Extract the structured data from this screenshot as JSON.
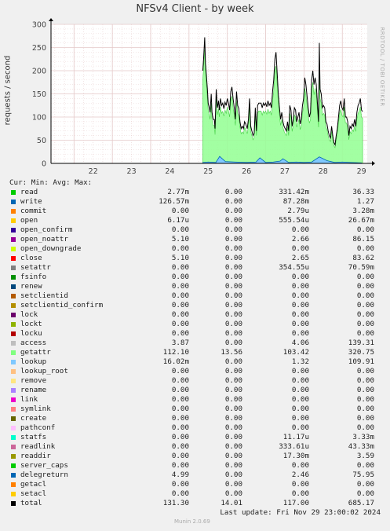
{
  "title": "NFSv4 Client - by week",
  "watermark": "RRDTOOL / TOBI OETIKER",
  "footer": "Last update: Fri Nov 29 23:00:02 2024",
  "version": "Munin 2.0.69",
  "colors": {
    "background": "#f0f0f0",
    "plot_background": "#ffffff",
    "grid": "#e4c8c8",
    "total_line": "#000000",
    "getattr_fill": "#99ff99"
  },
  "chart_data": {
    "type": "line",
    "title": "NFSv4 Client - by week",
    "xlabel": "",
    "ylabel": "requests / second",
    "x_range": [
      21.4,
      29.65
    ],
    "ylim": [
      0,
      300
    ],
    "yticks": [
      0,
      50,
      100,
      150,
      200,
      250,
      300
    ],
    "xticks": [
      22,
      23,
      24,
      25,
      26,
      27,
      28,
      29
    ],
    "xtick_labels": [
      "22",
      "23",
      "24",
      "25",
      "26",
      "27",
      "28",
      "29"
    ],
    "grid": true,
    "series": [
      {
        "name": "total",
        "color": "#000000",
        "x": [
          25.36,
          25.38,
          25.41,
          25.43,
          25.45,
          25.48,
          25.5,
          25.53,
          25.55,
          25.58,
          25.6,
          25.63,
          25.66,
          25.68,
          25.71,
          25.74,
          25.77,
          25.79,
          25.82,
          25.85,
          25.88,
          25.91,
          25.94,
          25.97,
          26.0,
          26.03,
          26.06,
          26.09,
          26.12,
          26.15,
          26.18,
          26.21,
          26.24,
          26.27,
          26.3,
          26.33,
          26.36,
          26.39,
          26.42,
          26.45,
          26.48,
          26.52,
          26.55,
          26.58,
          26.61,
          26.64,
          26.67,
          26.7,
          26.73,
          26.76,
          26.79,
          26.82,
          26.85,
          26.88,
          26.91,
          26.94,
          26.97,
          27.0,
          27.03,
          27.06,
          27.09,
          27.12,
          27.15,
          27.18,
          27.21,
          27.24,
          27.27,
          27.3,
          27.33,
          27.36,
          27.39,
          27.42,
          27.45,
          27.48,
          27.51,
          27.54,
          27.57,
          27.6,
          27.63,
          27.66,
          27.69,
          27.72,
          27.75,
          27.78,
          27.81,
          27.84,
          27.87,
          27.9,
          27.93,
          27.96,
          27.99,
          28.02,
          28.05,
          28.08,
          28.11,
          28.14,
          28.17,
          28.2,
          28.23,
          28.26,
          28.29,
          28.32,
          28.35,
          28.38,
          28.4,
          28.42,
          28.45,
          28.48,
          28.51,
          28.54,
          28.57,
          28.6,
          28.63,
          28.66,
          28.69,
          28.72,
          28.75,
          28.78,
          28.81,
          28.84,
          28.87,
          28.9,
          28.93,
          28.96,
          28.99,
          29.02,
          29.05,
          29.08,
          29.11,
          29.14,
          29.17,
          29.2,
          29.23,
          29.26,
          29.29,
          29.32,
          29.35,
          29.38,
          29.41,
          29.44,
          29.47,
          29.5,
          29.53
        ],
        "values": [
          200,
          225,
          272,
          215,
          195,
          160,
          130,
          120,
          110,
          150,
          110,
          95,
          95,
          75,
          160,
          120,
          135,
          115,
          140,
          125,
          130,
          118,
          132,
          125,
          140,
          130,
          115,
          155,
          165,
          140,
          120,
          95,
          155,
          125,
          118,
          90,
          75,
          80,
          75,
          90,
          85,
          75,
          95,
          140,
          80,
          70,
          60,
          65,
          120,
          70,
          125,
          130,
          130,
          130,
          120,
          130,
          125,
          130,
          122,
          135,
          125,
          130,
          120,
          155,
          180,
          225,
          240,
          195,
          150,
          120,
          95,
          110,
          90,
          80,
          75,
          70,
          90,
          70,
          125,
          115,
          80,
          95,
          120,
          115,
          90,
          100,
          110,
          85,
          95,
          125,
          140,
          185,
          170,
          145,
          120,
          100,
          110,
          180,
          200,
          170,
          185,
          170,
          130,
          90,
          260,
          160,
          150,
          120,
          125,
          120,
          90,
          85,
          70,
          60,
          55,
          80,
          60,
          45,
          40,
          60,
          75,
          100,
          125,
          135,
          120,
          115,
          140,
          100,
          100,
          90,
          60,
          80,
          75,
          85,
          80,
          95,
          80,
          110,
          125,
          130,
          140,
          115,
          112
        ]
      },
      {
        "name": "getattr",
        "color": "#99ff99",
        "x": [
          25.36,
          25.38,
          25.41,
          25.43,
          25.45,
          25.48,
          25.5,
          25.53,
          25.55,
          25.58,
          25.6,
          25.63,
          25.66,
          25.68,
          25.71,
          25.74,
          25.77,
          25.79,
          25.82,
          25.85,
          25.88,
          25.91,
          25.94,
          25.97,
          26.0,
          26.03,
          26.06,
          26.09,
          26.12,
          26.15,
          26.18,
          26.21,
          26.24,
          26.27,
          26.3,
          26.33,
          26.36,
          26.39,
          26.42,
          26.45,
          26.48,
          26.52,
          26.55,
          26.58,
          26.61,
          26.64,
          26.67,
          26.7,
          26.73,
          26.76,
          26.79,
          26.82,
          26.85,
          26.88,
          26.91,
          26.94,
          26.97,
          27.0,
          27.03,
          27.06,
          27.09,
          27.12,
          27.15,
          27.18,
          27.21,
          27.24,
          27.27,
          27.3,
          27.33,
          27.36,
          27.39,
          27.42,
          27.45,
          27.48,
          27.51,
          27.54,
          27.57,
          27.6,
          27.63,
          27.66,
          27.69,
          27.72,
          27.75,
          27.78,
          27.81,
          27.84,
          27.87,
          27.9,
          27.93,
          27.96,
          27.99,
          28.02,
          28.05,
          28.08,
          28.11,
          28.14,
          28.17,
          28.2,
          28.23,
          28.26,
          28.29,
          28.32,
          28.35,
          28.38,
          28.4,
          28.42,
          28.45,
          28.48,
          28.51,
          28.54,
          28.57,
          28.6,
          28.63,
          28.66,
          28.69,
          28.72,
          28.75,
          28.78,
          28.81,
          28.84,
          28.87,
          28.9,
          28.93,
          28.96,
          28.99,
          29.02,
          29.05,
          29.08,
          29.11,
          29.14,
          29.17,
          29.2,
          29.23,
          29.26,
          29.29,
          29.32,
          29.35,
          29.38,
          29.41,
          29.44,
          29.47,
          29.5,
          29.53
        ],
        "values": [
          180,
          205,
          245,
          195,
          175,
          140,
          115,
          105,
          95,
          130,
          95,
          82,
          82,
          62,
          140,
          105,
          118,
          100,
          122,
          108,
          112,
          102,
          115,
          108,
          122,
          113,
          100,
          135,
          145,
          122,
          104,
          82,
          135,
          108,
          102,
          78,
          64,
          68,
          64,
          78,
          73,
          64,
          82,
          122,
          69,
          60,
          51,
          56,
          104,
          60,
          108,
          113,
          113,
          113,
          104,
          113,
          108,
          113,
          106,
          117,
          108,
          113,
          104,
          135,
          157,
          197,
          210,
          170,
          130,
          104,
          82,
          95,
          78,
          69,
          64,
          60,
          78,
          60,
          108,
          100,
          69,
          82,
          104,
          100,
          78,
          87,
          95,
          73,
          82,
          108,
          122,
          162,
          148,
          126,
          104,
          87,
          95,
          157,
          175,
          148,
          162,
          148,
          113,
          78,
          200,
          140,
          130,
          104,
          108,
          104,
          78,
          73,
          60,
          51,
          47,
          69,
          51,
          38,
          34,
          51,
          64,
          87,
          108,
          117,
          104,
          100,
          122,
          87,
          87,
          78,
          51,
          69,
          64,
          73,
          69,
          82,
          69,
          95,
          108,
          113,
          122,
          100,
          97
        ]
      },
      {
        "name": "write",
        "color": "#0066b3",
        "x": [
          25.36,
          25.5,
          25.7,
          25.8,
          25.95,
          26.2,
          26.5,
          26.75,
          26.85,
          27.0,
          27.2,
          27.38,
          27.45,
          27.6,
          27.8,
          28.0,
          28.2,
          28.4,
          28.6,
          28.8,
          29.0,
          29.2,
          29.5
        ],
        "values": [
          2,
          3,
          2,
          15,
          4,
          3,
          2,
          3,
          12,
          2,
          3,
          5,
          10,
          2,
          3,
          2,
          3,
          14,
          6,
          2,
          3,
          2,
          1
        ]
      }
    ],
    "legend": {
      "headers": [
        "Cur:",
        "Min:",
        "Avg:",
        "Max:"
      ],
      "rows": [
        {
          "name": "read",
          "color": "#00cc00",
          "cur": "2.77m",
          "min": "0.00",
          "avg": "331.42m",
          "max": "36.33"
        },
        {
          "name": "write",
          "color": "#0066b3",
          "cur": "126.57m",
          "min": "0.00",
          "avg": "87.28m",
          "max": "1.27"
        },
        {
          "name": "commit",
          "color": "#ff8000",
          "cur": "0.00",
          "min": "0.00",
          "avg": "2.79u",
          "max": "3.28m"
        },
        {
          "name": "open",
          "color": "#ffcc00",
          "cur": "6.17u",
          "min": "0.00",
          "avg": "555.54u",
          "max": "26.67m"
        },
        {
          "name": "open_confirm",
          "color": "#330099",
          "cur": "0.00",
          "min": "0.00",
          "avg": "0.00",
          "max": "0.00"
        },
        {
          "name": "open_noattr",
          "color": "#990099",
          "cur": "5.10",
          "min": "0.00",
          "avg": "2.66",
          "max": "86.15"
        },
        {
          "name": "open_downgrade",
          "color": "#ccff00",
          "cur": "0.00",
          "min": "0.00",
          "avg": "0.00",
          "max": "0.00"
        },
        {
          "name": "close",
          "color": "#ff0000",
          "cur": "5.10",
          "min": "0.00",
          "avg": "2.65",
          "max": "83.62"
        },
        {
          "name": "setattr",
          "color": "#808080",
          "cur": "0.00",
          "min": "0.00",
          "avg": "354.55u",
          "max": "70.59m"
        },
        {
          "name": "fsinfo",
          "color": "#008f00",
          "cur": "0.00",
          "min": "0.00",
          "avg": "0.00",
          "max": "0.00"
        },
        {
          "name": "renew",
          "color": "#00487d",
          "cur": "0.00",
          "min": "0.00",
          "avg": "0.00",
          "max": "0.00"
        },
        {
          "name": "setclientid",
          "color": "#b35a00",
          "cur": "0.00",
          "min": "0.00",
          "avg": "0.00",
          "max": "0.00"
        },
        {
          "name": "setclientid_confirm",
          "color": "#b38f00",
          "cur": "0.00",
          "min": "0.00",
          "avg": "0.00",
          "max": "0.00"
        },
        {
          "name": "lock",
          "color": "#6b006b",
          "cur": "0.00",
          "min": "0.00",
          "avg": "0.00",
          "max": "0.00"
        },
        {
          "name": "lockt",
          "color": "#8fb300",
          "cur": "0.00",
          "min": "0.00",
          "avg": "0.00",
          "max": "0.00"
        },
        {
          "name": "locku",
          "color": "#b30000",
          "cur": "0.00",
          "min": "0.00",
          "avg": "0.00",
          "max": "0.00"
        },
        {
          "name": "access",
          "color": "#bebebe",
          "cur": "3.87",
          "min": "0.00",
          "avg": "4.06",
          "max": "139.31"
        },
        {
          "name": "getattr",
          "color": "#80ff80",
          "cur": "112.10",
          "min": "13.56",
          "avg": "103.42",
          "max": "320.75"
        },
        {
          "name": "lookup",
          "color": "#80c9ff",
          "cur": "16.02m",
          "min": "0.00",
          "avg": "1.32",
          "max": "109.91"
        },
        {
          "name": "lookup_root",
          "color": "#ffc080",
          "cur": "0.00",
          "min": "0.00",
          "avg": "0.00",
          "max": "0.00"
        },
        {
          "name": "remove",
          "color": "#ffe680",
          "cur": "0.00",
          "min": "0.00",
          "avg": "0.00",
          "max": "0.00"
        },
        {
          "name": "rename",
          "color": "#aa80ff",
          "cur": "0.00",
          "min": "0.00",
          "avg": "0.00",
          "max": "0.00"
        },
        {
          "name": "link",
          "color": "#ee00cc",
          "cur": "0.00",
          "min": "0.00",
          "avg": "0.00",
          "max": "0.00"
        },
        {
          "name": "symlink",
          "color": "#ff8080",
          "cur": "0.00",
          "min": "0.00",
          "avg": "0.00",
          "max": "0.00"
        },
        {
          "name": "create",
          "color": "#666600",
          "cur": "0.00",
          "min": "0.00",
          "avg": "0.00",
          "max": "0.00"
        },
        {
          "name": "pathconf",
          "color": "#ffbfff",
          "cur": "0.00",
          "min": "0.00",
          "avg": "0.00",
          "max": "0.00"
        },
        {
          "name": "statfs",
          "color": "#00ffcc",
          "cur": "0.00",
          "min": "0.00",
          "avg": "11.17u",
          "max": "3.33m"
        },
        {
          "name": "readlink",
          "color": "#cc6699",
          "cur": "0.00",
          "min": "0.00",
          "avg": "333.61u",
          "max": "43.33m"
        },
        {
          "name": "readdir",
          "color": "#999900",
          "cur": "0.00",
          "min": "0.00",
          "avg": "17.30m",
          "max": "3.59"
        },
        {
          "name": "server_caps",
          "color": "#00cc00",
          "cur": "0.00",
          "min": "0.00",
          "avg": "0.00",
          "max": "0.00"
        },
        {
          "name": "delegreturn",
          "color": "#0066b3",
          "cur": "4.99",
          "min": "0.00",
          "avg": "2.46",
          "max": "75.95"
        },
        {
          "name": "getacl",
          "color": "#ff8000",
          "cur": "0.00",
          "min": "0.00",
          "avg": "0.00",
          "max": "0.00"
        },
        {
          "name": "setacl",
          "color": "#ffcc00",
          "cur": "0.00",
          "min": "0.00",
          "avg": "0.00",
          "max": "0.00"
        },
        {
          "name": "total",
          "color": "#000000",
          "cur": "131.30",
          "min": "14.01",
          "avg": "117.00",
          "max": "685.17"
        }
      ]
    }
  }
}
